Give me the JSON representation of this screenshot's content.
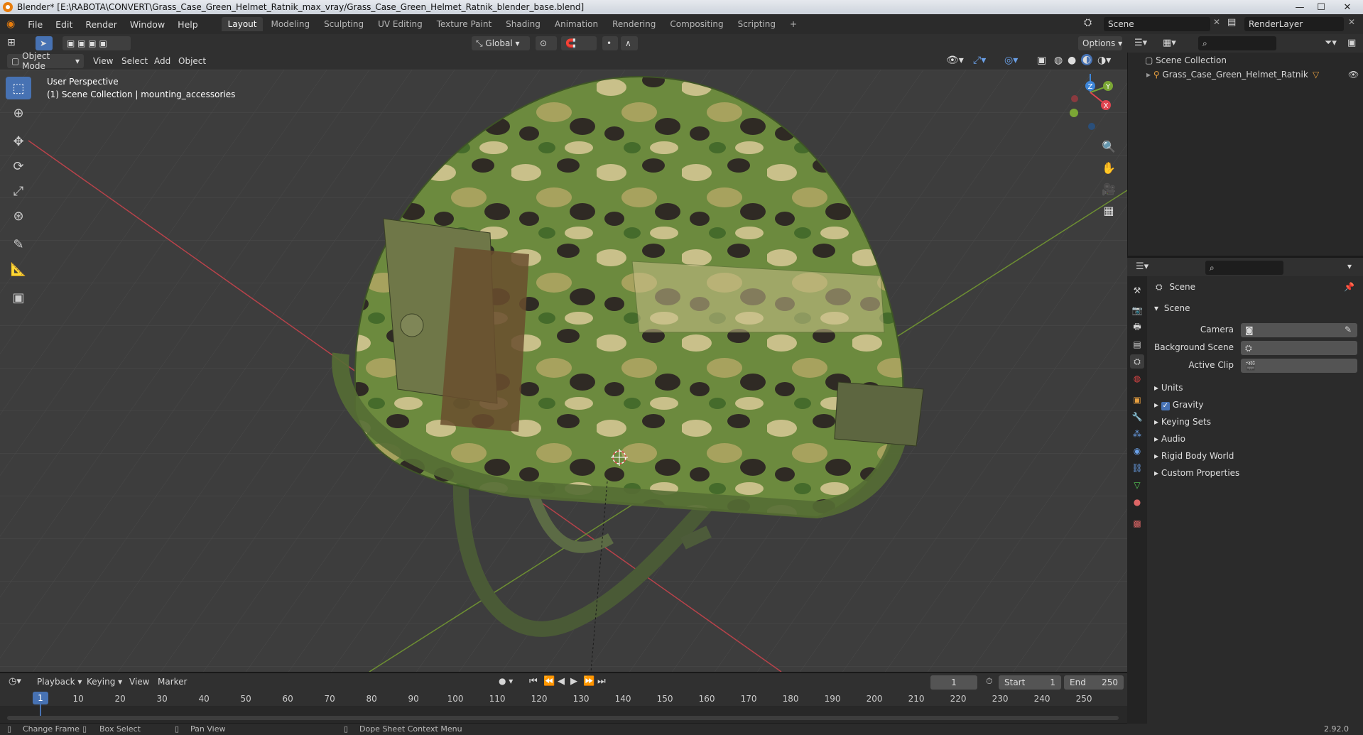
{
  "window": {
    "title": "Blender* [E:\\RABOTA\\CONVERT\\Grass_Case_Green_Helmet_Ratnik_max_vray/Grass_Case_Green_Helmet_Ratnik_blender_base.blend]",
    "min": "—",
    "max": "☐",
    "close": "✕"
  },
  "menu": [
    "File",
    "Edit",
    "Render",
    "Window",
    "Help"
  ],
  "workspaces": [
    "Layout",
    "Modeling",
    "Sculpting",
    "UV Editing",
    "Texture Paint",
    "Shading",
    "Animation",
    "Rendering",
    "Compositing",
    "Scripting"
  ],
  "workspace_add": "+",
  "scene_field": "Scene",
  "renderlayer_field": "RenderLayer",
  "viewport_header": {
    "transform_orientation": "Global",
    "options": "Options",
    "mode": "Object Mode",
    "menus": [
      "View",
      "Select",
      "Add",
      "Object"
    ]
  },
  "viewport": {
    "perspective": "User Perspective",
    "collection_info": "(1) Scene Collection | mounting_accessories",
    "gizmo_labels": {
      "z": "Z",
      "y": "Y",
      "x": "X"
    }
  },
  "outliner": {
    "root": "Scene Collection",
    "items": [
      "Grass_Case_Green_Helmet_Ratnik"
    ]
  },
  "properties": {
    "context": "Scene",
    "panel_title": "Scene",
    "fields": [
      {
        "label": "Camera",
        "value": ""
      },
      {
        "label": "Background Scene",
        "value": ""
      },
      {
        "label": "Active Clip",
        "value": ""
      }
    ],
    "subpanels": [
      "Units",
      "Gravity",
      "Keying Sets",
      "Audio",
      "Rigid Body World",
      "Custom Properties"
    ],
    "gravity_checked": true
  },
  "timeline": {
    "menus": [
      "Playback",
      "Keying",
      "View",
      "Marker"
    ],
    "current_frame": "1",
    "start_label": "Start",
    "start": "1",
    "end_label": "End",
    "end": "250",
    "ticks": [
      "1",
      "10",
      "20",
      "30",
      "40",
      "50",
      "60",
      "70",
      "80",
      "90",
      "100",
      "110",
      "120",
      "130",
      "140",
      "150",
      "160",
      "170",
      "180",
      "190",
      "200",
      "210",
      "220",
      "230",
      "240",
      "250"
    ]
  },
  "statusbar": {
    "items": [
      "Change Frame",
      "Box Select",
      "Pan View",
      "Dope Sheet Context Menu"
    ],
    "version": "2.92.0"
  },
  "colors": {
    "accent": "#4772b3",
    "x_axis": "#e0444f",
    "y_axis": "#7ba735",
    "z_axis": "#3e86d8",
    "camo_base": "#5a7a35",
    "camo_light": "#c9c08a",
    "camo_dark": "#2f2a24"
  }
}
